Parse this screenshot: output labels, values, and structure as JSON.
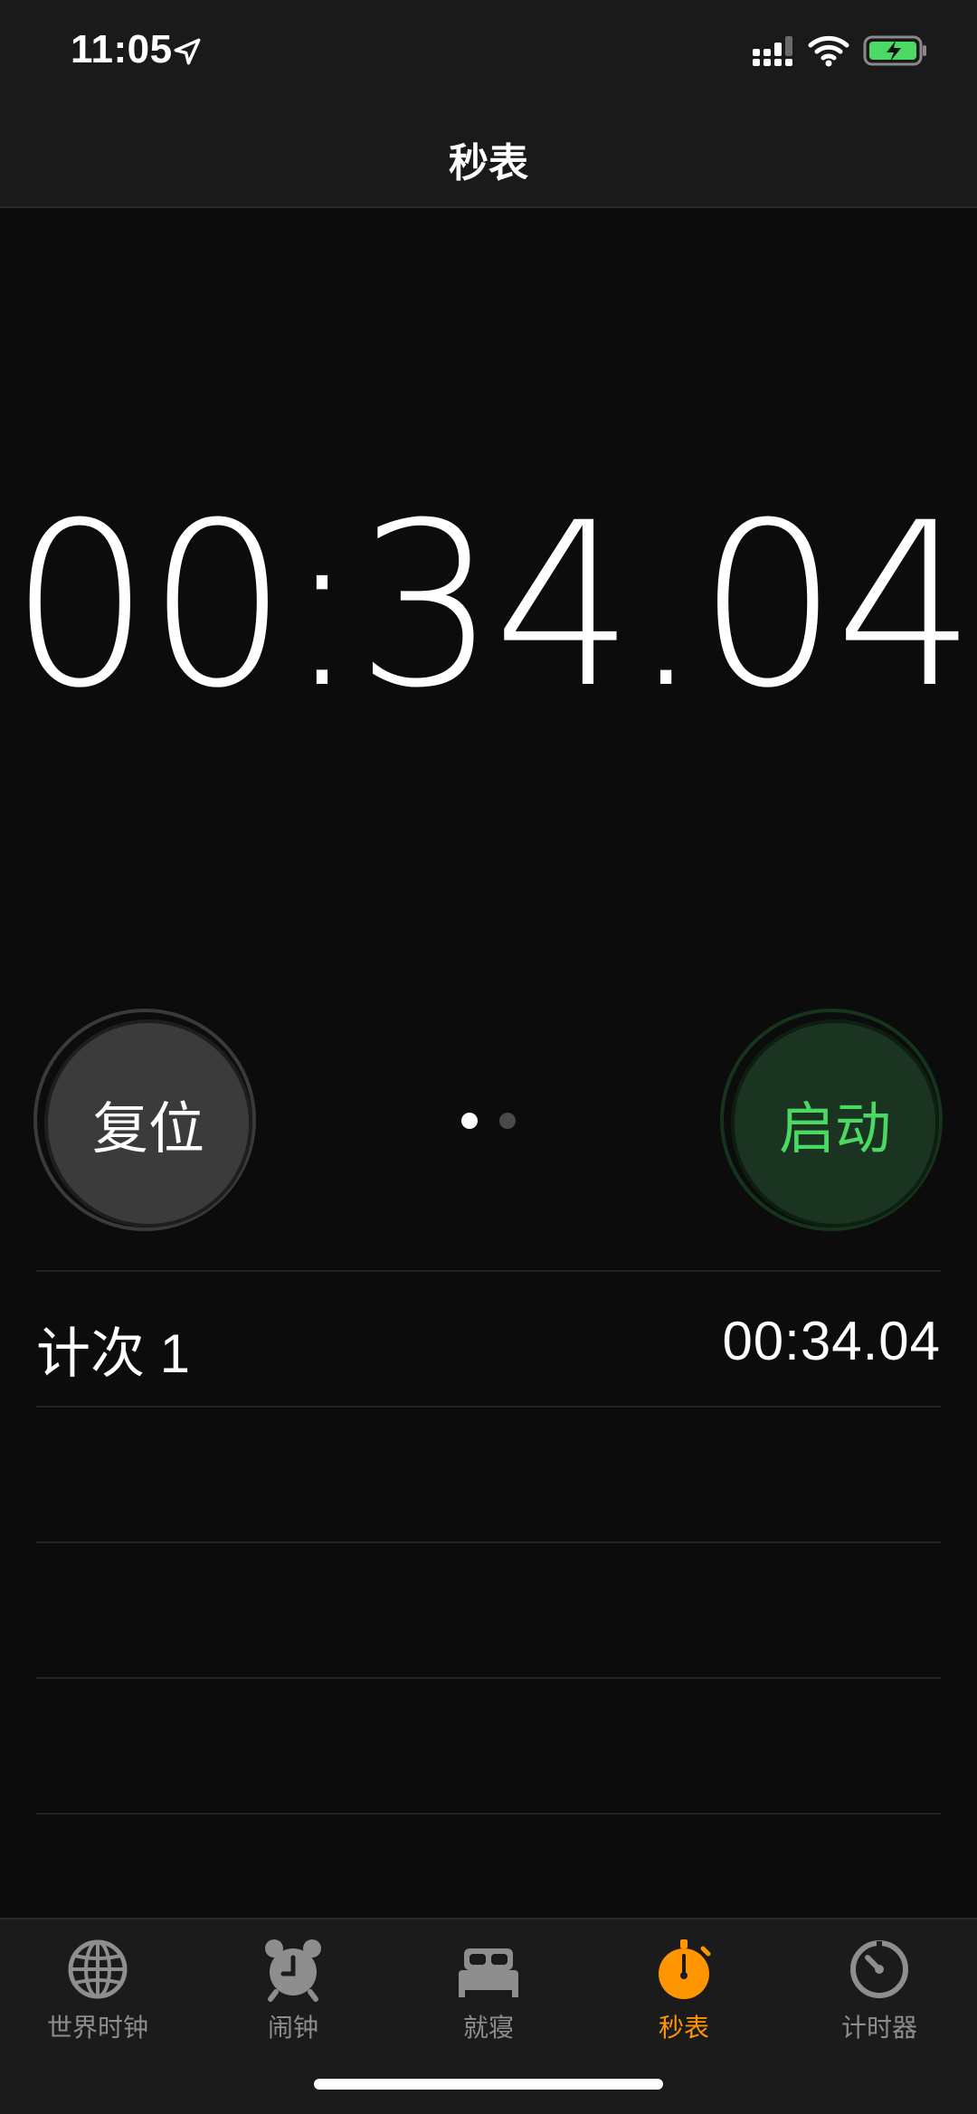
{
  "status_bar": {
    "time": "11:05"
  },
  "nav": {
    "title": "秒表"
  },
  "stopwatch": {
    "elapsed": "00:34.04"
  },
  "controls": {
    "reset_label": "复位",
    "start_label": "启动"
  },
  "laps": [
    {
      "label": "计次 1",
      "time": "00:34.04"
    }
  ],
  "tabs": [
    {
      "label": "世界时钟",
      "icon": "globe-icon"
    },
    {
      "label": "闹钟",
      "icon": "alarm-clock-icon"
    },
    {
      "label": "就寝",
      "icon": "bed-icon"
    },
    {
      "label": "秒表",
      "icon": "stopwatch-icon",
      "active": true
    },
    {
      "label": "计时器",
      "icon": "timer-icon"
    }
  ],
  "colors": {
    "accent": "#ff9500",
    "start_green": "#4bd964",
    "battery_green": "#4cd964"
  }
}
